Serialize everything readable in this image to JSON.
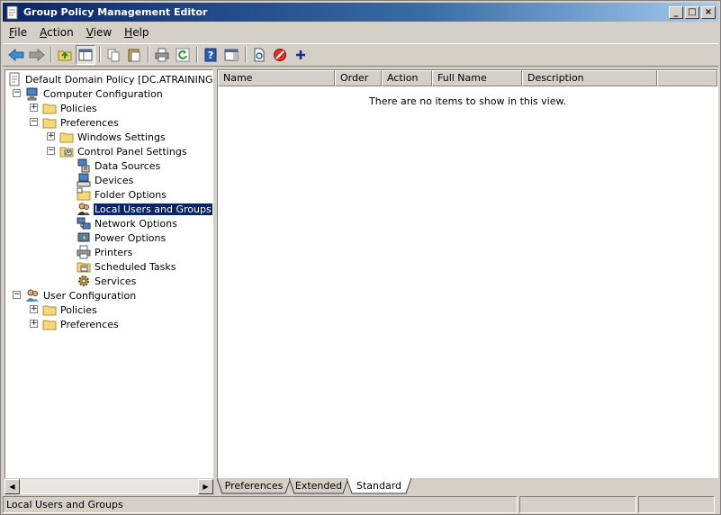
{
  "window": {
    "title": "Group Policy Management Editor"
  },
  "menu": [
    {
      "label": "File",
      "accel": "F",
      "rest": "ile"
    },
    {
      "label": "Action",
      "accel": "A",
      "rest": "ction"
    },
    {
      "label": "View",
      "accel": "V",
      "rest": "iew"
    },
    {
      "label": "Help",
      "accel": "H",
      "rest": "elp"
    }
  ],
  "toolbar": {
    "icons": [
      "back-icon",
      "forward-icon",
      "up-folder-icon",
      "show-hide-tree-icon",
      "copy-icon",
      "paste-icon",
      "print-icon",
      "refresh-icon",
      "help-icon",
      "action-pane-icon",
      "new-item-icon",
      "stop-icon",
      "add-icon"
    ]
  },
  "tree": {
    "root": "Default Domain Policy [DC.ATRAINING.LAB",
    "computer_config": "Computer Configuration",
    "policies": "Policies",
    "preferences": "Preferences",
    "windows_settings": "Windows Settings",
    "control_panel_settings": "Control Panel Settings",
    "cp_items": [
      "Data Sources",
      "Devices",
      "Folder Options",
      "Local Users and Groups",
      "Network Options",
      "Power Options",
      "Printers",
      "Scheduled Tasks",
      "Services"
    ],
    "selected_item": "Local Users and Groups",
    "user_config": "User Configuration",
    "user_policies": "Policies",
    "user_preferences": "Preferences"
  },
  "list": {
    "columns": [
      "Name",
      "Order",
      "Action",
      "Full Name",
      "Description"
    ],
    "empty_message": "There are no items to show in this view."
  },
  "tabs": {
    "items": [
      "Preferences",
      "Extended",
      "Standard"
    ],
    "active": "Standard"
  },
  "status": {
    "text": "Local Users and Groups"
  }
}
